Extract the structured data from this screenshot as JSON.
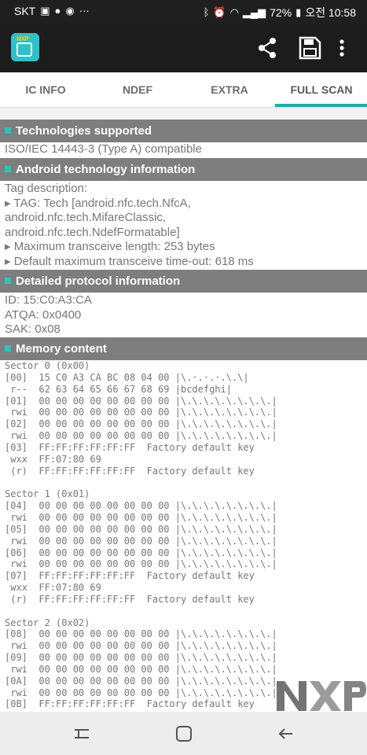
{
  "status_bar": {
    "carrier": "SKT",
    "battery": "72%",
    "time": "오전 10:58",
    "icons": [
      "notification-icon",
      "chat-icon",
      "message-icon",
      "more-dots-icon",
      "bluetooth-icon",
      "alarm-icon",
      "wifi-icon",
      "signal-icon",
      "battery-icon"
    ]
  },
  "app_bar": {
    "logo_text": "NXP",
    "actions": [
      "share-icon",
      "save-icon",
      "overflow-menu-icon"
    ]
  },
  "tabs": [
    {
      "label": "IC INFO",
      "active": false
    },
    {
      "label": "NDEF",
      "active": false
    },
    {
      "label": "EXTRA",
      "active": false
    },
    {
      "label": "FULL SCAN",
      "active": true
    }
  ],
  "accent_color": "#26a9a4",
  "sections": {
    "technologies": {
      "title": "Technologies supported",
      "lines": [
        "ISO/IEC 14443-3 (Type A) compatible"
      ]
    },
    "android_tech": {
      "title": "Android technology information",
      "lines": [
        "Tag description:",
        "▸ TAG: Tech [android.nfc.tech.NfcA,",
        "android.nfc.tech.MifareClassic,",
        "android.nfc.tech.NdefFormatable]",
        "▸ Maximum transceive length: 253 bytes",
        "▸ Default maximum transceive time-out: 618 ms"
      ]
    },
    "protocol": {
      "title": "Detailed protocol information",
      "lines": [
        "ID: 15:C0:A3:CA",
        "ATQA: 0x0400",
        "SAK: 0x08"
      ]
    },
    "memory": {
      "title": "Memory content",
      "lines": [
        "Sector 0 (0x00)",
        "[00]  15 C0 A3 CA BC 08 04 00 |\\.·.·.·.\\.\\|",
        " r--  62 63 64 65 66 67 68 69 |bcdefghi|",
        "[01]  00 00 00 00 00 00 00 00 |\\.\\.\\.\\.\\.\\.\\.\\.|",
        " rwi  00 00 00 00 00 00 00 00 |\\.\\.\\.\\.\\.\\.\\.\\.|",
        "[02]  00 00 00 00 00 00 00 00 |\\.\\.\\.\\.\\.\\.\\.\\.|",
        " rwi  00 00 00 00 00 00 00 00 |\\.\\.\\.\\.\\.\\.\\.\\.|",
        "[03]  FF:FF:FF:FF:FF:FF  Factory default key",
        " wxx  FF:07:80 69",
        " (r)  FF:FF:FF:FF:FF:FF  Factory default key",
        "",
        "Sector 1 (0x01)",
        "[04]  00 00 00 00 00 00 00 00 |\\.\\.\\.\\.\\.\\.\\.\\.|",
        " rwi  00 00 00 00 00 00 00 00 |\\.\\.\\.\\.\\.\\.\\.\\.|",
        "[05]  00 00 00 00 00 00 00 00 |\\.\\.\\.\\.\\.\\.\\.\\.|",
        " rwi  00 00 00 00 00 00 00 00 |\\.\\.\\.\\.\\.\\.\\.\\.|",
        "[06]  00 00 00 00 00 00 00 00 |\\.\\.\\.\\.\\.\\.\\.\\.|",
        " rwi  00 00 00 00 00 00 00 00 |\\.\\.\\.\\.\\.\\.\\.\\.|",
        "[07]  FF:FF:FF:FF:FF:FF  Factory default key",
        " wxx  FF:07:80 69",
        " (r)  FF:FF:FF:FF:FF:FF  Factory default key",
        "",
        "Sector 2 (0x02)",
        "[08]  00 00 00 00 00 00 00 00 |\\.\\.\\.\\.\\.\\.\\.\\.|",
        " rwi  00 00 00 00 00 00 00 00 |\\.\\.\\.\\.\\.\\.\\.\\.|",
        "[09]  00 00 00 00 00 00 00 00 |\\.\\.\\.\\.\\.\\.\\.\\.|",
        " rwi  00 00 00 00 00 00 00 00 |\\.\\.\\.\\.\\.\\.\\.\\.|",
        "[0A]  00 00 00 00 00 00 00 00 |\\.\\.\\.\\.\\.\\.\\.\\.|",
        " rwi  00 00 00 00 00 00 00 00 |\\.\\.\\.\\.\\.\\.\\.\\.|",
        "[0B]  FF:FF:FF:FF:FF:FF  Factory default key"
      ]
    }
  },
  "watermark_text": "NXP",
  "nav_bar": [
    "recents-icon",
    "home-icon",
    "back-icon"
  ]
}
